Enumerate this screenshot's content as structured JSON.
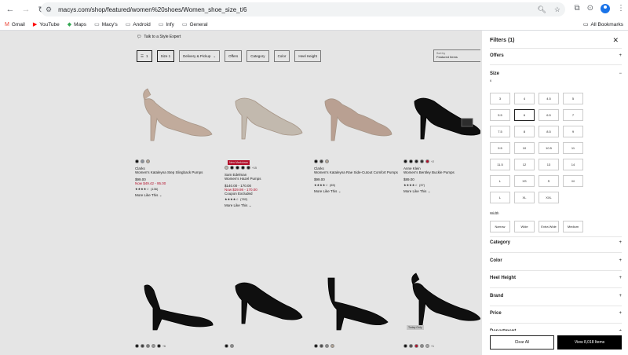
{
  "browser": {
    "url": "macys.com/shop/featured/women%20shoes/Women_shoe_size_t/6",
    "bookmarks": [
      {
        "label": "Gmail",
        "icon": "gmail-icon",
        "glyph": "M",
        "color": "#ea4335"
      },
      {
        "label": "YouTube",
        "icon": "youtube-icon",
        "glyph": "▶",
        "color": "#ff0000"
      },
      {
        "label": "Maps",
        "icon": "maps-icon",
        "glyph": "◆",
        "color": "#34a853"
      },
      {
        "label": "Macy's",
        "icon": "folder-icon",
        "glyph": "▭",
        "color": "#5f6368"
      },
      {
        "label": "Android",
        "icon": "folder-icon",
        "glyph": "▭",
        "color": "#5f6368"
      },
      {
        "label": "Infy",
        "icon": "folder-icon",
        "glyph": "▭",
        "color": "#5f6368"
      },
      {
        "label": "General",
        "icon": "folder-icon",
        "glyph": "▭",
        "color": "#5f6368"
      }
    ],
    "all_bookmarks": "All Bookmarks"
  },
  "page": {
    "stylist": "Talk to a Style Expert",
    "filter_count": "1",
    "chips": [
      "Size  1",
      "Delivery & Pickup",
      "Offers",
      "Category",
      "Color",
      "Heel Height"
    ],
    "sort_label": "Sort by",
    "sort_value": "Featured Items"
  },
  "products": [
    {
      "brand": "Clarks",
      "name": "Women's Kataleyna Step Slingback Pumps",
      "price": "$99.00",
      "sale": "Now $49.42 - 95.00",
      "promo": "",
      "reviews": "(136)",
      "more": "More Like This",
      "swatches": [
        "#111",
        "#9aa3b0",
        "#c9b8a6"
      ],
      "swatch_more": "",
      "badge": "",
      "shoe_color": "#d7bfae",
      "shoe_type": "slingback"
    },
    {
      "brand": "Sam Edelman",
      "name": "Women's Hazel Pumps",
      "price": "$140.00 - 170.00",
      "sale": "Now $29.98 - 170.00",
      "promo": "Coupon Excluded",
      "reviews": "(782)",
      "more": "More Like This",
      "swatches": [
        "#d9cfc2",
        "#111",
        "#111",
        "#111",
        "#222"
      ],
      "swatch_more": "+15",
      "badge": "New Markdown",
      "shoe_color": "#d9cfc2",
      "shoe_type": "pump"
    },
    {
      "brand": "Clarks",
      "name": "Women's Kataleyna Rae Side-Cutout Comfort Pumps",
      "price": "$99.00",
      "sale": "",
      "promo": "",
      "reviews": "(65)",
      "more": "More Like This",
      "swatches": [
        "#111",
        "#444",
        "#c9b8a6"
      ],
      "swatch_more": "",
      "badge": "",
      "shoe_color": "#cfb3a3",
      "shoe_type": "cutout"
    },
    {
      "brand": "Anne Klein",
      "name": "Women's Bentley Buckle Pumps",
      "price": "$89.00",
      "sale": "",
      "promo": "",
      "reviews": "(37)",
      "more": "More Like This",
      "swatches": [
        "#111",
        "#111",
        "#222",
        "#333",
        "#c8102e"
      ],
      "swatch_more": "+2",
      "badge": "",
      "shoe_color": "#111",
      "shoe_type": "buckle"
    },
    {
      "brand": "",
      "name": "",
      "price": "",
      "sale": "",
      "promo": "",
      "reviews": "",
      "more": "",
      "swatches": [
        "#111",
        "#444",
        "#888",
        "#aaa",
        "#111"
      ],
      "swatch_more": "+6",
      "badge": "",
      "shoe_color": "#111",
      "shoe_type": "dorsay"
    },
    {
      "brand": "",
      "name": "",
      "price": "",
      "sale": "",
      "promo": "",
      "reviews": "",
      "more": "",
      "swatches": [
        "#111",
        "#999"
      ],
      "swatch_more": "",
      "badge": "",
      "shoe_color": "#111",
      "shoe_type": "pump"
    },
    {
      "brand": "",
      "name": "",
      "price": "",
      "sale": "",
      "promo": "",
      "reviews": "",
      "more": "",
      "swatches": [
        "#111",
        "#555",
        "#999",
        "#c9b8a6"
      ],
      "swatch_more": "",
      "badge": "",
      "shoe_color": "#111",
      "shoe_type": "sandal"
    },
    {
      "brand": "",
      "name": "",
      "price": "",
      "sale": "",
      "promo": "",
      "reviews": "",
      "more": "",
      "swatches": [
        "#111",
        "#555",
        "#c8102e",
        "#999",
        "#bbb"
      ],
      "swatch_more": "+1",
      "badge": "Today Only",
      "shoe_color": "#111",
      "shoe_type": "slingback"
    }
  ],
  "filters": {
    "title": "Filters (1)",
    "sections_top": [
      "Offers"
    ],
    "size_title": "Size",
    "size_selected": "6",
    "sizes": [
      "3",
      "4",
      "4.5",
      "5",
      "5.5",
      "6",
      "6.5",
      "7",
      "7.5",
      "8",
      "8.5",
      "9",
      "9.5",
      "10",
      "10.5",
      "11",
      "11.5",
      "12",
      "13",
      "14",
      "L",
      "XS",
      "S",
      "M",
      "L",
      "XL",
      "XXL"
    ],
    "width_title": "Width",
    "widths": [
      "Narrow",
      "Wide",
      "Extra Wide",
      "Medium"
    ],
    "sections_bottom": [
      "Category",
      "Color",
      "Heel Height",
      "Brand",
      "Price",
      "Department"
    ],
    "clear_all": "Clear All",
    "view_items": "View 8,018 Items"
  }
}
